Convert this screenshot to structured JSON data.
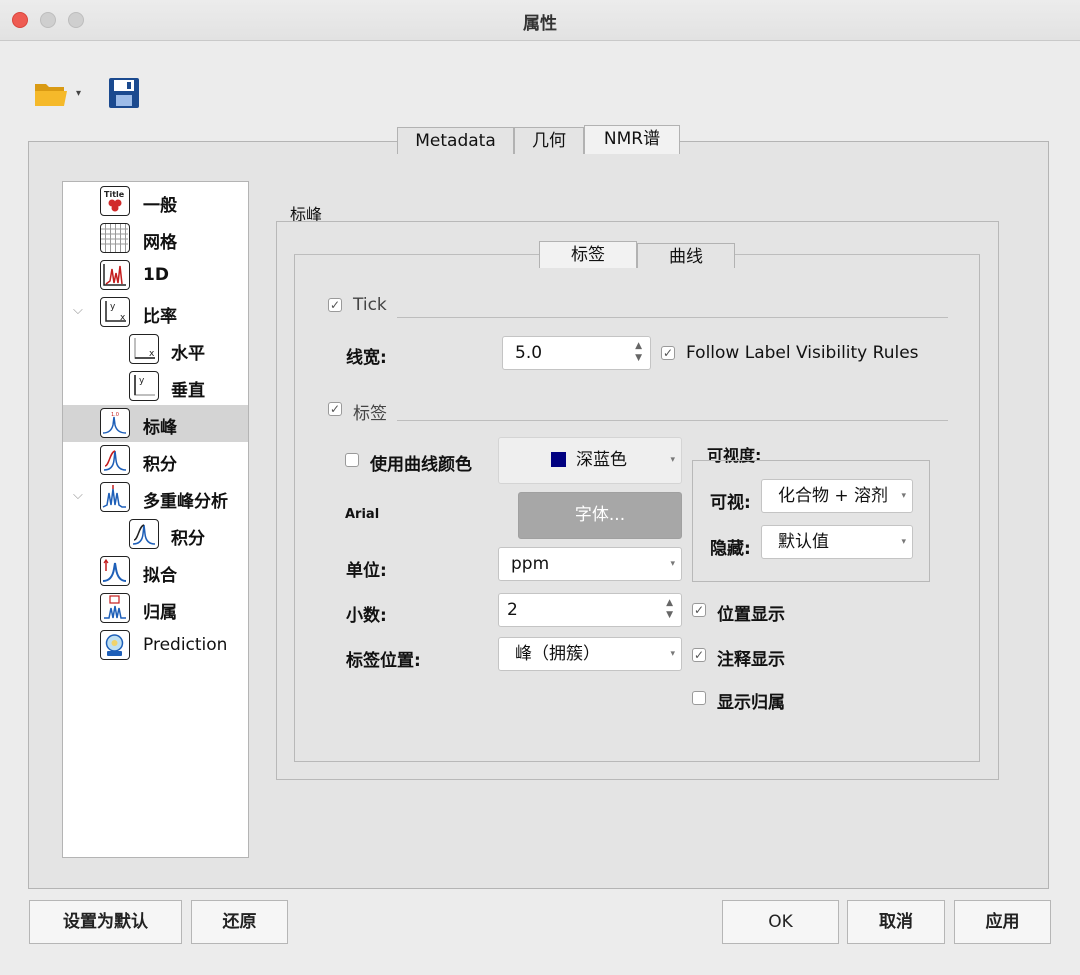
{
  "window": {
    "title": "属性"
  },
  "tabs": [
    "Metadata",
    "几何",
    "NMR谱"
  ],
  "tree": [
    {
      "label": "一般",
      "icon": "title-icon"
    },
    {
      "label": "网格",
      "icon": "grid-icon"
    },
    {
      "label": "1D",
      "icon": "spectrum-1d-icon"
    },
    {
      "label": "比率",
      "icon": "axes-icon"
    },
    {
      "label": "水平",
      "icon": "horizontal-axis-icon"
    },
    {
      "label": "垂直",
      "icon": "vertical-axis-icon"
    },
    {
      "label": "标峰",
      "icon": "peak-pick-icon"
    },
    {
      "label": "积分",
      "icon": "integral-icon"
    },
    {
      "label": "多重峰分析",
      "icon": "multiplet-icon"
    },
    {
      "label": "积分",
      "icon": "integral-icon"
    },
    {
      "label": "拟合",
      "icon": "fitting-icon"
    },
    {
      "label": "归属",
      "icon": "assignment-icon"
    },
    {
      "label": "Prediction",
      "icon": "prediction-icon"
    }
  ],
  "section": {
    "title": "标峰",
    "subtabs": [
      "标签",
      "曲线"
    ],
    "tick": {
      "label": "Tick",
      "checked": true,
      "line_width_label": "线宽:",
      "line_width_value": "5.0",
      "follow_label": "Follow Label Visibility Rules",
      "follow_checked": true
    },
    "labels": {
      "label": "标签",
      "checked": true,
      "use_curve_color_label": "使用曲线颜色",
      "use_curve_color_checked": false,
      "color_value": "深蓝色",
      "color_swatch": "#000080",
      "font_name": "Arial",
      "font_button": "字体...",
      "unit_label": "单位:",
      "unit_value": "ppm",
      "decimals_label": "小数:",
      "decimals_value": "2",
      "position_label": "标签位置:",
      "position_value": "峰（拥簇）",
      "visibility_title": "可视度:",
      "visible_label": "可视:",
      "visible_value": "化合物 + 溶剂",
      "hidden_label": "隐藏:",
      "hidden_value": "默认值",
      "show_position_label": "位置显示",
      "show_position_checked": true,
      "show_annotation_label": "注释显示",
      "show_annotation_checked": true,
      "show_assignment_label": "显示归属",
      "show_assignment_checked": false
    }
  },
  "buttons": {
    "set_default": "设置为默认",
    "restore": "还原",
    "ok": "OK",
    "cancel": "取消",
    "apply": "应用"
  }
}
